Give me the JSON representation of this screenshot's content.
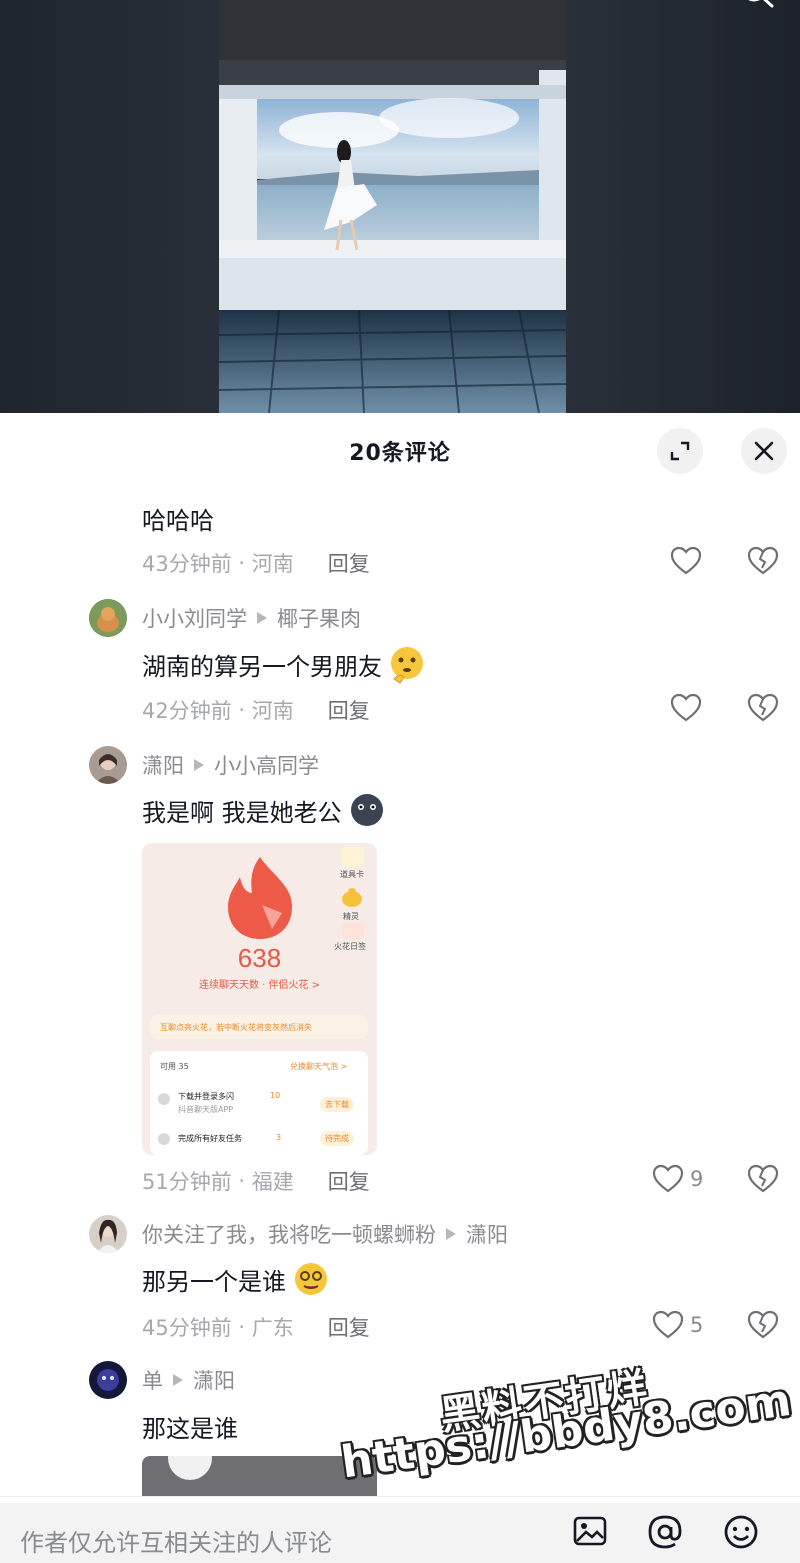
{
  "panel": {
    "title": "20条评论"
  },
  "comments": [
    {
      "text": "哈哈哈",
      "time": "43分钟前",
      "location": "河南",
      "reply_label": "回复",
      "likes": ""
    },
    {
      "author": "小小刘同学",
      "reply_to": "椰子果肉",
      "text": "湖南的算另一个男朋友",
      "emoji": "thinking-emoji",
      "time": "42分钟前",
      "location": "河南",
      "reply_label": "回复",
      "likes": ""
    },
    {
      "author": "潇阳",
      "reply_to": "小小高同学",
      "text": "我是啊 我是她老公",
      "emoji": "dark-face-emoji",
      "time": "51分钟前",
      "location": "福建",
      "reply_label": "回复",
      "likes": "9",
      "image": {
        "count": "638",
        "subtitle": "连续聊天天数 · 伴侣火花 >",
        "side_labels": [
          "道具卡",
          "精灵",
          "火花日签"
        ],
        "notice": "互聊点亮火花，若中断火花将变灰然后消失",
        "card_header_left": "可用 35",
        "card_header_right": "兑换聊天气泡 >",
        "tasks": [
          {
            "title": "下载并登录多闪",
            "points": "10",
            "desc": "抖音聊天版APP",
            "action": "去下载"
          },
          {
            "title": "完成所有好友任务",
            "points": "3",
            "desc": "",
            "action": "待完成"
          }
        ]
      }
    },
    {
      "author": "你关注了我，我将吃一顿螺蛳粉",
      "reply_to": "潇阳",
      "text": "那另一个是谁",
      "emoji": "dizzy-face-emoji",
      "time": "45分钟前",
      "location": "广东",
      "reply_label": "回复",
      "likes": "5"
    },
    {
      "author": "单",
      "reply_to": "潇阳",
      "text": "那这是谁"
    }
  ],
  "input": {
    "placeholder": "作者仅允许互相关注的人评论"
  },
  "watermark": {
    "text": "黑料不打烊",
    "url": "https://bbdy8.com"
  },
  "colors": {
    "text_primary": "#161823",
    "text_secondary": "#8a8b91",
    "accent_red": "#e35a44"
  }
}
